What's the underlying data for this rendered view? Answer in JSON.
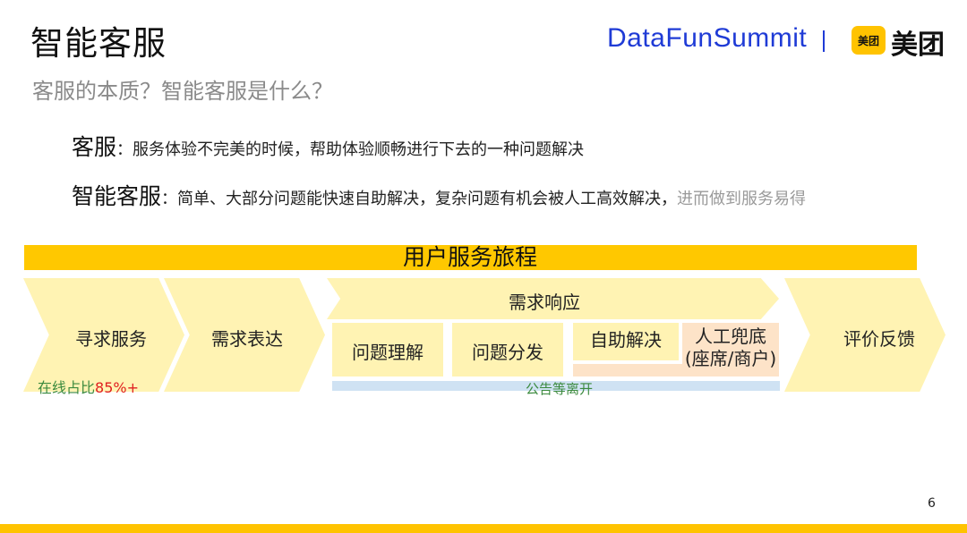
{
  "header": {
    "title": "智能客服",
    "subtitle": "客服的本质？智能客服是什么？",
    "brand": "DataFunSummit",
    "logo_box": "美团",
    "logo_text": "美团"
  },
  "definitions": {
    "kefu": {
      "term": "客服",
      "text": "：服务体验不完美的时候，帮助体验顺畅进行下去的一种问题解决"
    },
    "smart": {
      "term": "智能客服",
      "text": "：简单、大部分问题能快速自助解决，复杂问题有机会被人工高效解决，",
      "muted": "进而做到服务易得"
    }
  },
  "journey": {
    "title": "用户服务旅程",
    "stages": {
      "seek": "寻求服务",
      "express": "需求表达",
      "response": "需求响应",
      "understand": "问题理解",
      "dispatch": "问题分发",
      "self_solve": "自助解决",
      "manual_line1": "人工兜底",
      "manual_line2": "(座席/商户)",
      "evaluate": "评价反馈"
    },
    "notice": "公告等离开",
    "online": {
      "label": "在线占比",
      "pct": "85%+"
    }
  },
  "page_number": "6",
  "colors": {
    "accent_yellow": "#ffc800",
    "chevron_fill": "#fff3b3",
    "peach": "#fde3c8",
    "blue_bar": "#cfe2f3",
    "brand_blue": "#1f3bd6",
    "green_text": "#3b8a3e",
    "red_text": "#e02020"
  }
}
